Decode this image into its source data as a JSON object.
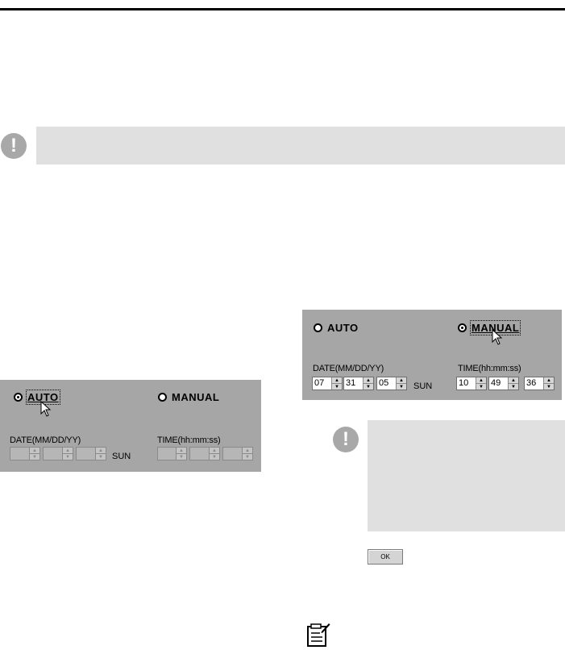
{
  "left_panel": {
    "auto_label": "AUTO",
    "manual_label": "MANUAL",
    "date_label": "DATE(MM/DD/YY)",
    "time_label": "TIME(hh:mm:ss)",
    "day": "SUN",
    "date_values": [
      "",
      "",
      ""
    ],
    "time_values": [
      "",
      "",
      ""
    ],
    "selected": "AUTO"
  },
  "right_panel": {
    "auto_label": "AUTO",
    "manual_label": "MANUAL",
    "date_label": "DATE(MM/DD/YY)",
    "time_label": "TIME(hh:mm:ss)",
    "day": "SUN",
    "date_values": [
      "07",
      "31",
      "05"
    ],
    "time_values": [
      "10",
      "49",
      "36"
    ],
    "selected": "MANUAL"
  },
  "ok_button": {
    "label": "OK"
  },
  "colors": {
    "panel_bg": "#a6a6a6",
    "note_bg": "#e0e0e0",
    "icon_gray": "#a8a8a8"
  },
  "icons": {
    "alert": "exclamation-icon",
    "memo": "memo-pencil-icon",
    "cursor": "mouse-pointer-icon"
  }
}
